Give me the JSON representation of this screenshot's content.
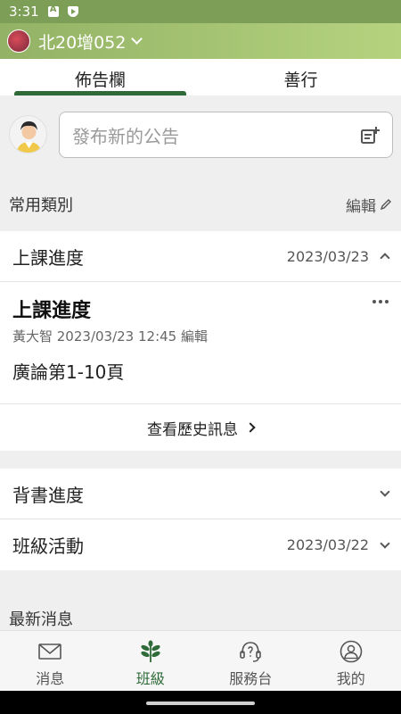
{
  "status_bar": {
    "time": "3:31"
  },
  "app_bar": {
    "group_name": "北20增052"
  },
  "tabs": [
    {
      "label": "佈告欄",
      "active": true
    },
    {
      "label": "善行",
      "active": false
    }
  ],
  "composer": {
    "placeholder": "發布新的公告"
  },
  "categories": {
    "title": "常用類別",
    "edit_label": "編輯",
    "rows": [
      {
        "name": "上課進度",
        "date": "2023/03/23",
        "expanded": true
      },
      {
        "name": "背書進度",
        "date": "",
        "expanded": false
      },
      {
        "name": "班級活動",
        "date": "2023/03/22",
        "expanded": false
      }
    ]
  },
  "post": {
    "title": "上課進度",
    "meta": "黃大智 2023/03/23 12:45 編輯",
    "body": "廣論第1-10頁",
    "history_label": "查看歷史訊息"
  },
  "news": {
    "title": "最新消息"
  },
  "bottom_nav": [
    {
      "label": "消息",
      "icon": "mail-icon",
      "active": false
    },
    {
      "label": "班級",
      "icon": "sprout-icon",
      "active": true
    },
    {
      "label": "服務台",
      "icon": "headset-icon",
      "active": false
    },
    {
      "label": "我的",
      "icon": "profile-icon",
      "active": false
    }
  ],
  "colors": {
    "accent": "#2e6b38",
    "header": "#93b265",
    "status_bar": "#7d9e57"
  }
}
